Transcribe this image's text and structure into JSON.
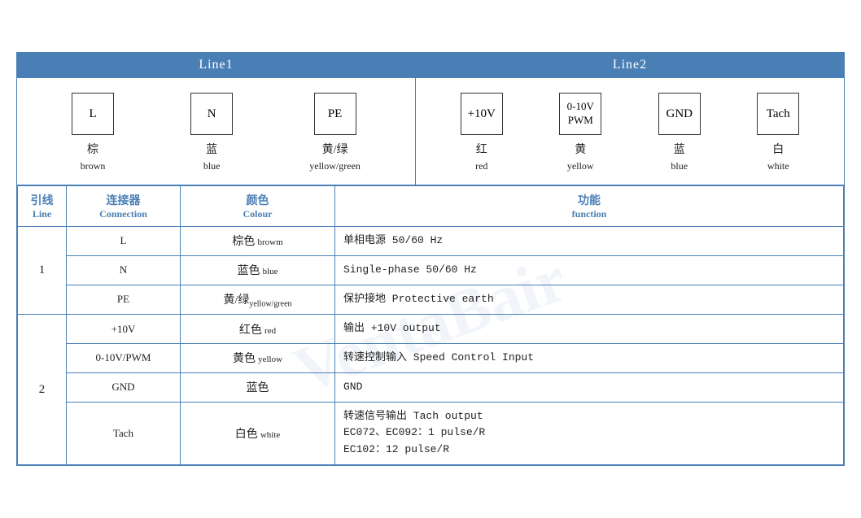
{
  "header": {
    "line1_label": "Line1",
    "line2_label": "Line2"
  },
  "diagram": {
    "line1_connectors": [
      {
        "symbol": "L",
        "cn": "棕",
        "en": "brown"
      },
      {
        "symbol": "N",
        "cn": "蓝",
        "en": "blue"
      },
      {
        "symbol": "PE",
        "cn": "黄/绿",
        "en": "yellow/green"
      }
    ],
    "line2_connectors": [
      {
        "symbol": "+10V",
        "cn": "红",
        "en": "red"
      },
      {
        "symbol": "0-10V\nPWM",
        "cn": "黄",
        "en": "yellow"
      },
      {
        "symbol": "GND",
        "cn": "蓝",
        "en": "blue"
      },
      {
        "symbol": "Tach",
        "cn": "白",
        "en": "white"
      }
    ]
  },
  "table": {
    "headers": {
      "line_cn": "引线",
      "line_en": "Line",
      "conn_cn": "连接器",
      "conn_en": "Connection",
      "color_cn": "颜色",
      "color_en": "Colour",
      "func_cn": "功能",
      "func_en": "function"
    },
    "rows": [
      {
        "line": "1",
        "rowspan": 3,
        "entries": [
          {
            "conn": "L",
            "color_cn": "棕色",
            "color_en": "browm",
            "func": "单相电源 50/60 Hz"
          },
          {
            "conn": "N",
            "color_cn": "蓝色",
            "color_en": "blue",
            "func": "Single-phase 50/60 Hz"
          },
          {
            "conn": "PE",
            "color_cn": "黄/绿",
            "color_en": "yellow/green",
            "func": "保护接地 Protective earth"
          }
        ]
      },
      {
        "line": "2",
        "rowspan": 4,
        "entries": [
          {
            "conn": "+10V",
            "color_cn": "红色",
            "color_en": "red",
            "func": "输出 +10V output"
          },
          {
            "conn": "0-10V/PWM",
            "color_cn": "黄色",
            "color_en": "yellow",
            "func": "转速控制输入 Speed Control Input"
          },
          {
            "conn": "GND",
            "color_cn": "蓝色",
            "color_en": "",
            "func": "GND"
          },
          {
            "conn": "Tach",
            "color_cn": "白色",
            "color_en": "white",
            "func_lines": [
              "转速信号输出 Tach output",
              "EC072、EC092：1 pulse/R",
              "EC102：12 pulse/R"
            ]
          }
        ]
      }
    ]
  }
}
